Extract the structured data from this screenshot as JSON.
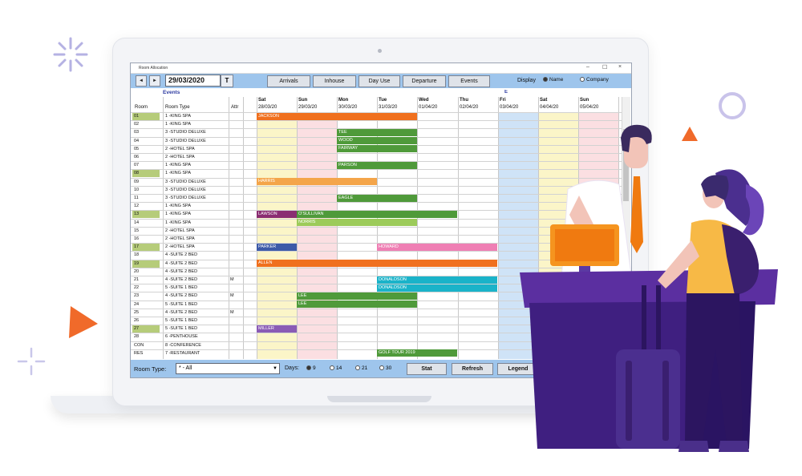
{
  "colors": {
    "toolbar": "#9ec5ec",
    "sat": "#fbf5c8",
    "sun": "#fbdfe2",
    "fri": "#cfe3f7",
    "desk": "#4a2a8c",
    "accent_orange": "#f0701e"
  },
  "window": {
    "title": "Room Allocation",
    "min": "–",
    "max": "☐",
    "close": "×"
  },
  "toolbar": {
    "prev": "◄",
    "next": "►",
    "date": "29/03/2020",
    "today": "T",
    "buttons": [
      "Arrivals",
      "Inhouse",
      "Day Use",
      "Departure",
      "Events"
    ],
    "display_label": "Display",
    "opt_name": "Name",
    "opt_company": "Company"
  },
  "grid": {
    "events_label": "Events",
    "event_marker": "E",
    "col_room": "Room",
    "col_type": "Room Type",
    "col_attr": "Attr",
    "days": [
      {
        "dow": "Sat",
        "date": "28/03/20"
      },
      {
        "dow": "Sun",
        "date": "29/03/20"
      },
      {
        "dow": "Mon",
        "date": "30/03/20"
      },
      {
        "dow": "Tue",
        "date": "31/03/20"
      },
      {
        "dow": "Wed",
        "date": "01/04/20"
      },
      {
        "dow": "Thu",
        "date": "02/04/20"
      },
      {
        "dow": "Fri",
        "date": "03/04/20"
      },
      {
        "dow": "Sat",
        "date": "04/04/20"
      },
      {
        "dow": "Sun",
        "date": "05/04/20"
      }
    ],
    "rows": [
      {
        "room": "01",
        "type": "1   -KING SPA",
        "attr": "",
        "hl": true
      },
      {
        "room": "02",
        "type": "1   -KING SPA",
        "attr": ""
      },
      {
        "room": "03",
        "type": "3   -STUDIO DELUXE",
        "attr": ""
      },
      {
        "room": "04",
        "type": "3   -STUDIO DELUXE",
        "attr": ""
      },
      {
        "room": "05",
        "type": "2   -HOTEL SPA",
        "attr": ""
      },
      {
        "room": "06",
        "type": "2   -HOTEL SPA",
        "attr": ""
      },
      {
        "room": "07",
        "type": "1   -KING SPA",
        "attr": ""
      },
      {
        "room": "08",
        "type": "1   -KING SPA",
        "attr": "",
        "hl": true
      },
      {
        "room": "09",
        "type": "3   -STUDIO DELUXE",
        "attr": ""
      },
      {
        "room": "10",
        "type": "3   -STUDIO DELUXE",
        "attr": ""
      },
      {
        "room": "11",
        "type": "3   -STUDIO DELUXE",
        "attr": ""
      },
      {
        "room": "12",
        "type": "1   -KING SPA",
        "attr": ""
      },
      {
        "room": "13",
        "type": "1   -KING SPA",
        "attr": "",
        "hl": true
      },
      {
        "room": "14",
        "type": "1   -KING SPA",
        "attr": ""
      },
      {
        "room": "15",
        "type": "2   -HOTEL SPA",
        "attr": ""
      },
      {
        "room": "16",
        "type": "2   -HOTEL SPA",
        "attr": ""
      },
      {
        "room": "17",
        "type": "2   -HOTEL SPA",
        "attr": "",
        "hl": true
      },
      {
        "room": "18",
        "type": "4   -SUITE 2 BED",
        "attr": ""
      },
      {
        "room": "19",
        "type": "4   -SUITE 2 BED",
        "attr": "",
        "hl": true
      },
      {
        "room": "20",
        "type": "4   -SUITE 2 BED",
        "attr": ""
      },
      {
        "room": "21",
        "type": "4   -SUITE 2 BED",
        "attr": "M"
      },
      {
        "room": "22",
        "type": "5   -SUITE 1 BED",
        "attr": ""
      },
      {
        "room": "23",
        "type": "4   -SUITE 2 BED",
        "attr": "M"
      },
      {
        "room": "24",
        "type": "5   -SUITE 1 BED",
        "attr": ""
      },
      {
        "room": "25",
        "type": "4   -SUITE 2 BED",
        "attr": "M"
      },
      {
        "room": "26",
        "type": "5   -SUITE 1 BED",
        "attr": ""
      },
      {
        "room": "27",
        "type": "5   -SUITE 1 BED",
        "attr": "",
        "hl": true
      },
      {
        "room": "28",
        "type": "6   -PENTHOUSE",
        "attr": ""
      },
      {
        "room": "CON",
        "type": "8   -CONFERENCE",
        "attr": ""
      },
      {
        "room": "RES",
        "type": "7   -RESTAURANT",
        "attr": ""
      }
    ],
    "bookings": [
      {
        "row": 0,
        "start": 0,
        "len": 4,
        "name": "JACKSON",
        "color": "#f0701e"
      },
      {
        "row": 2,
        "start": 2,
        "len": 2,
        "name": "TEE",
        "color": "#4f9a3a"
      },
      {
        "row": 3,
        "start": 2,
        "len": 2,
        "name": "WOOD",
        "color": "#4f9a3a"
      },
      {
        "row": 4,
        "start": 2,
        "len": 2,
        "name": "FAIRWAY",
        "color": "#4f9a3a"
      },
      {
        "row": 6,
        "start": 2,
        "len": 2,
        "name": "PARSON",
        "color": "#4f9a3a"
      },
      {
        "row": 8,
        "start": 0,
        "len": 3,
        "name": "HARRIS",
        "color": "#f4a54a"
      },
      {
        "row": 10,
        "start": 2,
        "len": 2,
        "name": "EAGLE",
        "color": "#4f9a3a"
      },
      {
        "row": 12,
        "start": 0,
        "len": 1,
        "name": "LAWSON",
        "color": "#8a2d72"
      },
      {
        "row": 12,
        "start": 1,
        "len": 4,
        "name": "O'SULLIVAN",
        "color": "#4f9a3a"
      },
      {
        "row": 13,
        "start": 1,
        "len": 3,
        "name": "NORRIS",
        "color": "#9ccb5a"
      },
      {
        "row": 16,
        "start": 0,
        "len": 1,
        "name": "PARKER",
        "color": "#3d5aa8"
      },
      {
        "row": 16,
        "start": 3,
        "len": 3,
        "name": "HOWARD",
        "color": "#ef7fb4"
      },
      {
        "row": 18,
        "start": 0,
        "len": 6,
        "name": "ALLEN",
        "color": "#f0701e"
      },
      {
        "row": 20,
        "start": 3,
        "len": 3,
        "name": "DONALDSON",
        "color": "#1ab3c9"
      },
      {
        "row": 21,
        "start": 3,
        "len": 3,
        "name": "DONALDSON",
        "color": "#1ab3c9"
      },
      {
        "row": 22,
        "start": 1,
        "len": 3,
        "name": "LEE",
        "color": "#4f9a3a"
      },
      {
        "row": 23,
        "start": 1,
        "len": 3,
        "name": "LEE",
        "color": "#4f9a3a"
      },
      {
        "row": 26,
        "start": 0,
        "len": 1,
        "name": "MILLER",
        "color": "#8a5bb5"
      },
      {
        "row": 29,
        "start": 3,
        "len": 2,
        "name": "GOLF TOUR 2019",
        "color": "#4f9a3a"
      }
    ]
  },
  "footer": {
    "roomtype_label": "Room Type:",
    "roomtype_value": "* - All",
    "days_label": "Days:",
    "day_options": [
      "9",
      "14",
      "21",
      "30"
    ],
    "btn_stat": "Stat",
    "btn_refresh": "Refresh",
    "btn_legend": "Legend"
  }
}
